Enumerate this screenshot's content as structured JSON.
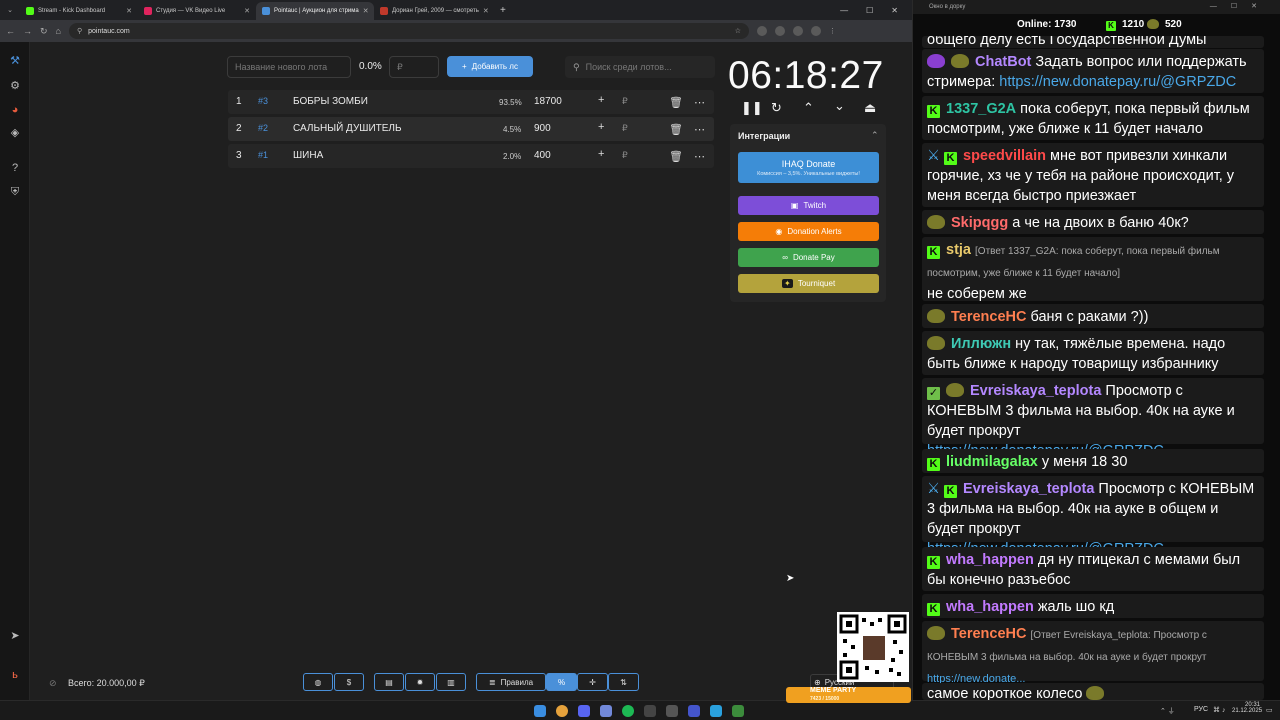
{
  "browser": {
    "tabs": [
      {
        "title": "Stream - Kick Dashboard",
        "color": "#53fc18"
      },
      {
        "title": "Студия — VK Видео Live",
        "color": "#e0245e"
      },
      {
        "title": "Pointauc | Аукцион для стрима",
        "color": "#4a90d9"
      },
      {
        "title": "Дориан Грей, 2009 — смотреть",
        "color": "#c0392b"
      }
    ],
    "url": "pointauc.com",
    "new_tab": "+"
  },
  "app": {
    "new_lot_placeholder": "Название нового лота",
    "percent": "0.0%",
    "currency": "₽",
    "add_button": "Добавить лс",
    "search_placeholder": "Поиск среди лотов...",
    "lots": [
      {
        "num": "1",
        "id": "#3",
        "name": "БОБРЫ ЗОМБИ",
        "pct": "93.5%",
        "amount": "18700"
      },
      {
        "num": "2",
        "id": "#2",
        "name": "САЛЬНЫЙ ДУШИТЕЛЬ",
        "pct": "4.5%",
        "amount": "900"
      },
      {
        "num": "3",
        "id": "#1",
        "name": "ШИНА",
        "pct": "2.0%",
        "amount": "400"
      }
    ],
    "timer": "06:18:27",
    "integrations_title": "Интеграции",
    "integrations": [
      {
        "label": "IHAQ Donate",
        "sub": "Комиссия – 3,5%. Уникальные виджеты!",
        "color": "#3d8fd6"
      },
      {
        "label": "Twitch",
        "color": "#7d4ed8"
      },
      {
        "label": "Donation Alerts",
        "color": "#f57d07"
      },
      {
        "label": "Donate Pay",
        "color": "#3fa34d"
      },
      {
        "label": "Tourniquet",
        "color": "#b4a33c"
      }
    ],
    "total": "Всего: 20.000,00 ₽",
    "rules_button": "Правила",
    "language": "Русский"
  },
  "chat": {
    "window_title": "Окно в дорку",
    "online_label": "Online:",
    "online": "1730",
    "followers": "1210",
    "subs": "520",
    "partial_top": "общего делу есть Государственной Думы",
    "messages": [
      {
        "user": "ChatBot",
        "color": "#b488ff",
        "text": "Задать вопрос или поддержать стримера: ",
        "link": "https://new.donatepay.ru/@GRPZDC"
      },
      {
        "user": "1337_G2A",
        "color": "#2ec4a3",
        "text": "пока соберут, пока первый фильм посмотрим, уже ближе к 11 будет начало"
      },
      {
        "user": "speedvillain",
        "color": "#ff4a4a",
        "text": "мне вот привезли хинкали горячие, хз че у тебя на районе происходит, у меня всегда быстро приезжает"
      },
      {
        "user": "Skipqgg",
        "color": "#ff6b6b",
        "text": "а че на двоих в баню 40к?"
      },
      {
        "user": "stja",
        "color": "#e8c96b",
        "reply": "[Ответ 1337_G2A: пока соберут, пока первый фильм посмотрим, уже ближе к 11 будет начало]",
        "text": "не соберем же"
      },
      {
        "user": "TerenceHC",
        "color": "#ff7f50",
        "text": "баня с раками ?))"
      },
      {
        "user": "Иллюжн",
        "color": "#3ec9b4",
        "text": "ну так, тяжёлые времена. надо быть ближе к народу товарищу избраннику"
      },
      {
        "user": "Evreiskaya_teplota",
        "color": "#b488ff",
        "text": "Просмотр с КОНЕВЫМ 3 фильма на выбор. 40к на ауке и будет прокрут ",
        "link": "https://new.donatepay.ru/@GRPZDC"
      },
      {
        "user": "liudmilagalax",
        "color": "#66ff66",
        "text": "у меня 18 30"
      },
      {
        "user": "Evreiskaya_teplota",
        "color": "#b488ff",
        "text": "Просмотр с КОНЕВЫМ 3 фильма на выбор. 40к на ауке в общем и будет прокрут ",
        "link": "https://new.donatepay.ru/@GRPZDC"
      },
      {
        "user": "wha_happen",
        "color": "#c27aff",
        "text": "дя ну птицекал с мемами был бы конечно разъебос"
      },
      {
        "user": "wha_happen",
        "color": "#c27aff",
        "text": "жаль шо кд"
      },
      {
        "user": "TerenceHC",
        "color": "#ff7f50",
        "reply": "[Ответ Evreiskaya_teplota: Просмотр с КОНЕВЫМ 3 фильма на выбор. 40к на ауке и будет прокрут",
        "link": "https://new.donate...",
        "text": ""
      },
      {
        "user": "",
        "color": "#ffffff",
        "text": "самое короткое колесо"
      }
    ]
  },
  "taskbar": {
    "lang": "РУС",
    "time": "20:31",
    "date": "21.12.2025",
    "meme_party": "MEME PARTY",
    "meme_progress": "7423 / 15000"
  }
}
